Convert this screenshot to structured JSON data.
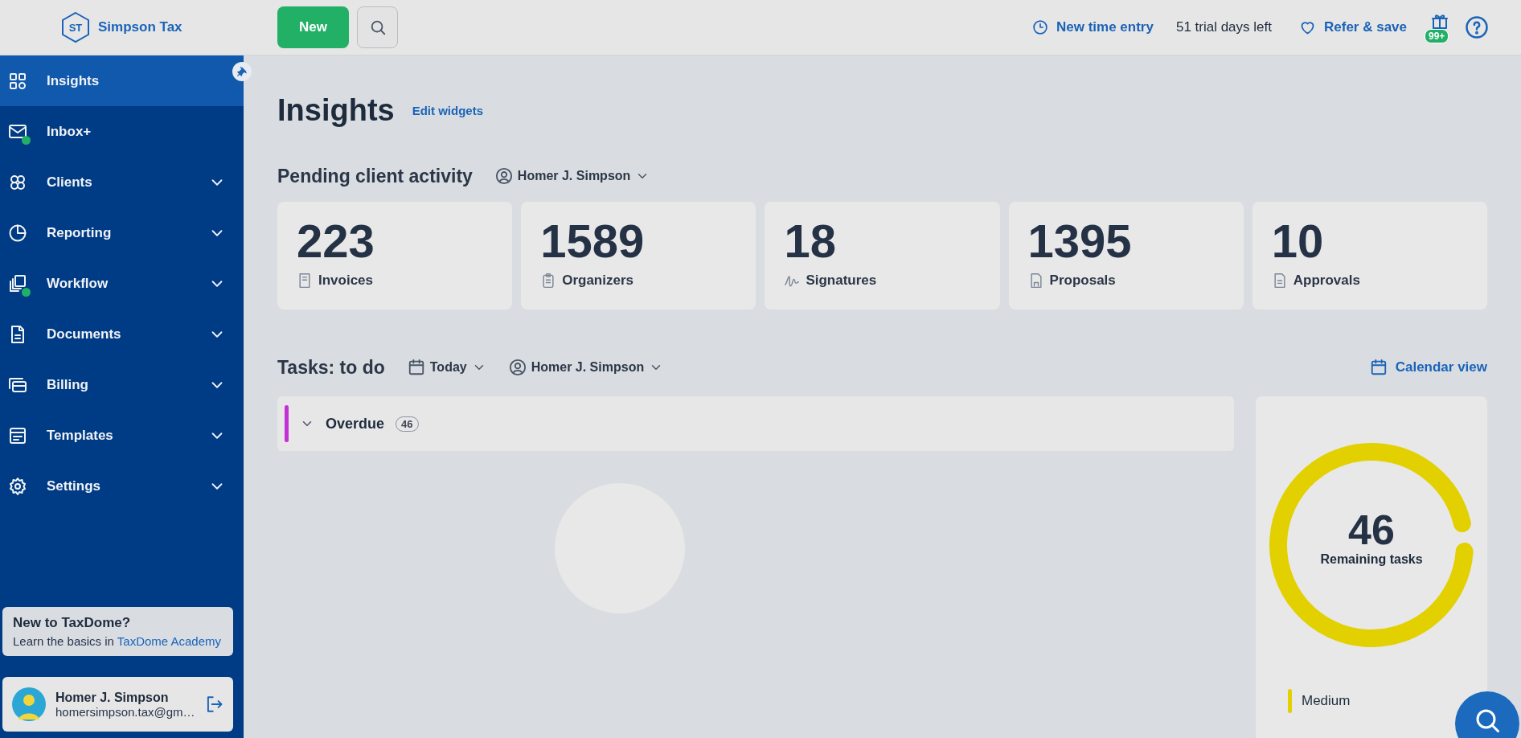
{
  "topbar": {
    "logo_initials": "ST",
    "firm_name": "Simpson Tax",
    "new_button": "New",
    "time_entry": "New time entry",
    "trial": "51 trial days left",
    "refer": "Refer & save",
    "gift_badge": "99+"
  },
  "sidebar": {
    "items": [
      {
        "label": "Insights",
        "selected": true,
        "dot": false,
        "expandable": false
      },
      {
        "label": "Inbox+",
        "selected": false,
        "dot": true,
        "expandable": false
      },
      {
        "label": "Clients",
        "selected": false,
        "dot": false,
        "expandable": true
      },
      {
        "label": "Reporting",
        "selected": false,
        "dot": false,
        "expandable": true
      },
      {
        "label": "Workflow",
        "selected": false,
        "dot": true,
        "expandable": true
      },
      {
        "label": "Documents",
        "selected": false,
        "dot": false,
        "expandable": true
      },
      {
        "label": "Billing",
        "selected": false,
        "dot": false,
        "expandable": true
      },
      {
        "label": "Templates",
        "selected": false,
        "dot": false,
        "expandable": true
      },
      {
        "label": "Settings",
        "selected": false,
        "dot": false,
        "expandable": true
      }
    ],
    "promo": {
      "title": "New to TaxDome?",
      "text": "Learn the basics in ",
      "link": "TaxDome Academy"
    },
    "user": {
      "name": "Homer J. Simpson",
      "email": "homersimpson.tax@gm…"
    }
  },
  "page": {
    "title": "Insights",
    "edit_link": "Edit widgets",
    "pending": {
      "title": "Pending client activity",
      "filter": "Homer J. Simpson",
      "cards": [
        {
          "value": "223",
          "label": "Invoices"
        },
        {
          "value": "1589",
          "label": "Organizers"
        },
        {
          "value": "18",
          "label": "Signatures"
        },
        {
          "value": "1395",
          "label": "Proposals"
        },
        {
          "value": "10",
          "label": "Approvals"
        }
      ]
    },
    "tasks": {
      "title": "Tasks: to do",
      "date_filter": "Today",
      "user_filter": "Homer J. Simpson",
      "calendar_link": "Calendar view",
      "groups": [
        {
          "label": "Overdue",
          "count": "46",
          "expanded": false,
          "color": "#c42fd6"
        }
      ],
      "summary": {
        "total": "46",
        "caption": "Remaining tasks",
        "legend": [
          {
            "label": "Medium",
            "color": "#e3d000"
          }
        ]
      }
    }
  }
}
